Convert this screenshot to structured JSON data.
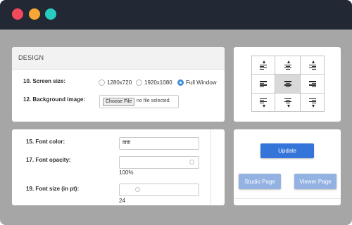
{
  "design": {
    "title": "DESIGN",
    "screen_size_label": "10. Screen size:",
    "screen_options": [
      "1280x720",
      "1920x1080",
      "Full Window"
    ],
    "selected_screen_option": "Full Window",
    "background_label": "12. Background image:",
    "choose_file_label": "Choose File",
    "file_status": "no file selected"
  },
  "fonts": {
    "color_label": "15. Font color:",
    "color_value": "ffffff",
    "opacity_label": "17. Font opacity:",
    "opacity_value": "100%",
    "opacity_level": 1.0,
    "size_label": "19. Font size (in pt):",
    "size_value": "24"
  },
  "alignment": {
    "options": [
      "top-left",
      "top-center",
      "top-right",
      "middle-left",
      "middle-center",
      "middle-right",
      "bottom-left",
      "bottom-center",
      "bottom-right"
    ],
    "selected": "middle-center"
  },
  "actions": {
    "update_label": "Update",
    "studio_label": "Studio Page",
    "viewer_label": "Viewer Page"
  },
  "colors": {
    "titlebar": "#232934",
    "background": "#a6a6a6",
    "close_dot": "#f2495c",
    "minimize_dot": "#f7a733",
    "maximize_dot": "#27ccc1",
    "primary_button": "#3574d8",
    "secondary_button": "#93b2e2",
    "radio_selected": "#3d8ed9"
  }
}
